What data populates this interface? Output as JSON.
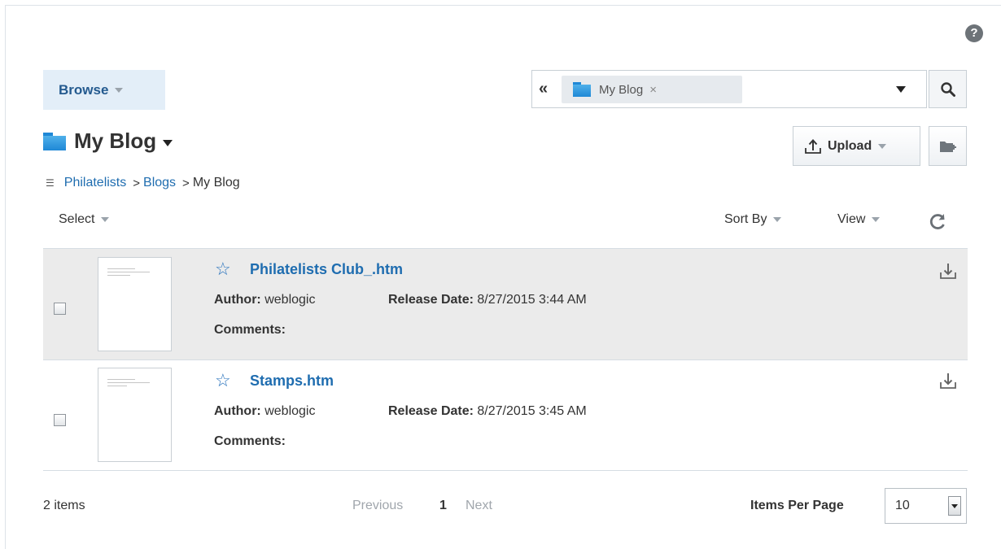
{
  "help_icon": "?",
  "browse": {
    "label": "Browse"
  },
  "search": {
    "collapse_icon": "«",
    "chip_label": "My Blog",
    "chip_remove": "×"
  },
  "header": {
    "title": "My Blog",
    "upload_label": "Upload"
  },
  "breadcrumb": {
    "items": [
      {
        "label": "Philatelists"
      },
      {
        "label": "Blogs"
      }
    ],
    "separator": ">",
    "current": "My Blog"
  },
  "toolbar": {
    "select_label": "Select",
    "sort_label": "Sort By",
    "view_label": "View"
  },
  "labels": {
    "author": "Author:",
    "release": "Release Date:",
    "comments": "Comments:"
  },
  "files": [
    {
      "name": "Philatelists Club_.htm",
      "author": "weblogic",
      "release_date": "8/27/2015 3:44 AM",
      "comments": ""
    },
    {
      "name": "Stamps.htm",
      "author": "weblogic",
      "release_date": "8/27/2015 3:45 AM",
      "comments": ""
    }
  ],
  "footer": {
    "count": "2 items",
    "previous": "Previous",
    "page": "1",
    "next": "Next",
    "ipp_label": "Items Per Page",
    "ipp_value": "10"
  },
  "colors": {
    "link": "#1f6db0",
    "accent": "#245a8f",
    "selected_row": "#ebebeb"
  },
  "icons": [
    "help-icon",
    "folder-icon",
    "search-icon",
    "upload-icon",
    "new-folder-icon",
    "star-icon",
    "download-icon",
    "refresh-icon"
  ]
}
